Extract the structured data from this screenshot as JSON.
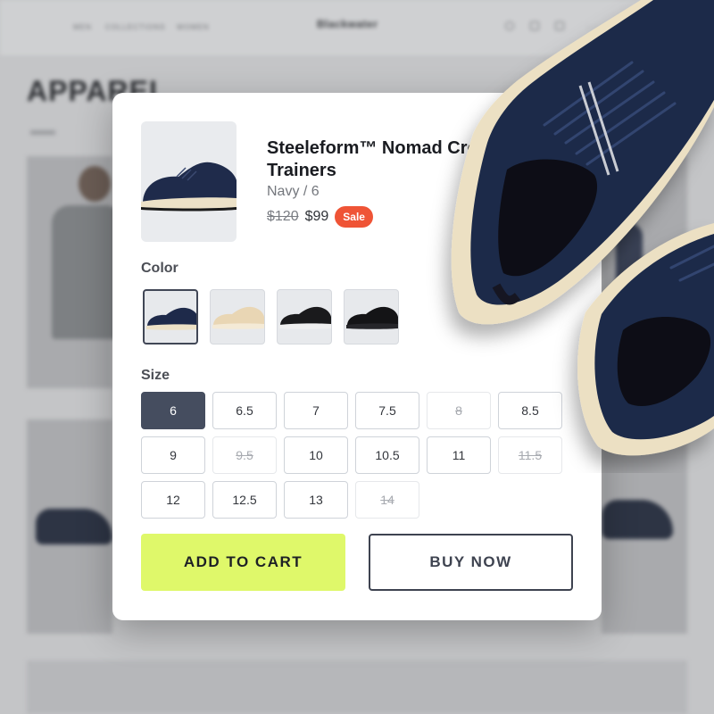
{
  "background": {
    "nav": [
      "Men",
      "Collections",
      "Women"
    ],
    "logo": "Blackwater",
    "page_title": "APPAREL"
  },
  "product": {
    "name": "Steeleform™ Nomad Cross Trainers",
    "variant": "Navy / 6",
    "old_price": "$120",
    "price": "$99",
    "badge": "Sale"
  },
  "color": {
    "label": "Color",
    "options": [
      {
        "name": "navy",
        "upper": "#1e2a4a",
        "sole": "#ede1c6",
        "selected": true
      },
      {
        "name": "tan",
        "upper": "#e9d6b4",
        "sole": "#f4ead6",
        "selected": false
      },
      {
        "name": "black-white",
        "upper": "#1a1a1c",
        "sole": "#efefef",
        "selected": false
      },
      {
        "name": "black",
        "upper": "#141416",
        "sole": "#222226",
        "selected": false
      }
    ]
  },
  "size": {
    "label": "Size",
    "options": [
      {
        "label": "6",
        "state": "selected"
      },
      {
        "label": "6.5",
        "state": "available"
      },
      {
        "label": "7",
        "state": "available"
      },
      {
        "label": "7.5",
        "state": "available"
      },
      {
        "label": "8",
        "state": "unavailable"
      },
      {
        "label": "8.5",
        "state": "available"
      },
      {
        "label": "9",
        "state": "available"
      },
      {
        "label": "9.5",
        "state": "unavailable"
      },
      {
        "label": "10",
        "state": "available"
      },
      {
        "label": "10.5",
        "state": "available"
      },
      {
        "label": "11",
        "state": "available"
      },
      {
        "label": "11.5",
        "state": "unavailable"
      },
      {
        "label": "12",
        "state": "available"
      },
      {
        "label": "12.5",
        "state": "available"
      },
      {
        "label": "13",
        "state": "available"
      },
      {
        "label": "14",
        "state": "unavailable"
      }
    ]
  },
  "actions": {
    "add_to_cart": "ADD TO CART",
    "buy_now": "BUY NOW"
  },
  "colors": {
    "accent": "#dff86a",
    "sale": "#ef5436",
    "selected": "#454d5f"
  }
}
